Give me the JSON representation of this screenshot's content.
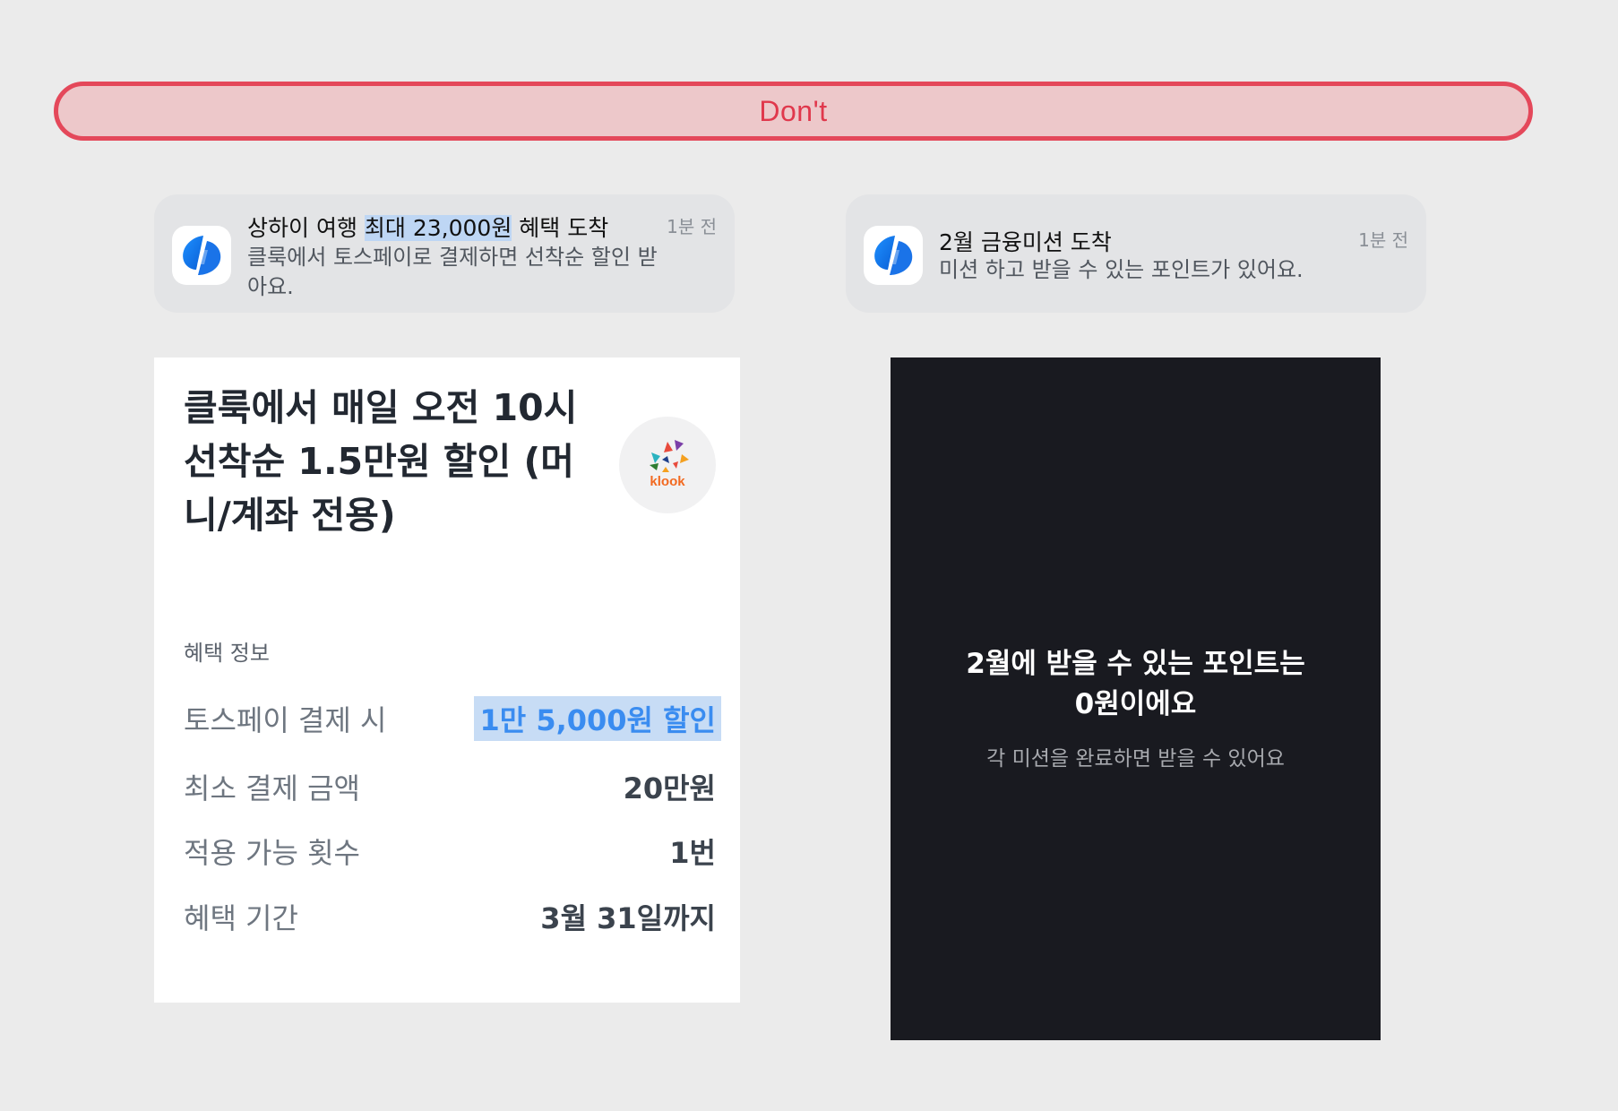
{
  "banner": {
    "label": "Don't",
    "border_color": "#e4485a",
    "fill_color": "#edc8ca"
  },
  "notifications": [
    {
      "icon": "toss-logo-icon",
      "title_before": "상하이 여행 ",
      "title_highlight": "최대 23,000원",
      "title_after": " 혜택 도착",
      "body": "클룩에서 토스페이로 결제하면 선착순 할인 받아요.",
      "time": "1분 전"
    },
    {
      "icon": "toss-logo-icon",
      "title": "2월 금융미션 도착",
      "body": "미션 하고 받을 수 있는 포인트가 있어요.",
      "time": "1분 전"
    }
  ],
  "detail": {
    "title": "클룩에서 매일 오전 10시 선착순 1.5만원 할인 (머니/계좌 전용)",
    "logo_text": "klook",
    "section_label": "혜택 정보",
    "rows": [
      {
        "label": "토스페이 결제 시",
        "value": "1만 5,000원 할인"
      },
      {
        "label": "최소 결제 금액",
        "value": "20만원"
      },
      {
        "label": "적용 가능 횟수",
        "value": "1번"
      },
      {
        "label": "혜택 기간",
        "value": "3월 31일까지"
      }
    ]
  },
  "dark_card": {
    "title_line1": "2월에 받을 수 있는 포인트는",
    "title_line2": "0원이에요",
    "subtitle": "각 미션을 완료하면 받을 수 있어요"
  },
  "colors": {
    "background": "#ebebeb",
    "highlight": "#3a8cf0",
    "dark_card": "#191a20"
  }
}
